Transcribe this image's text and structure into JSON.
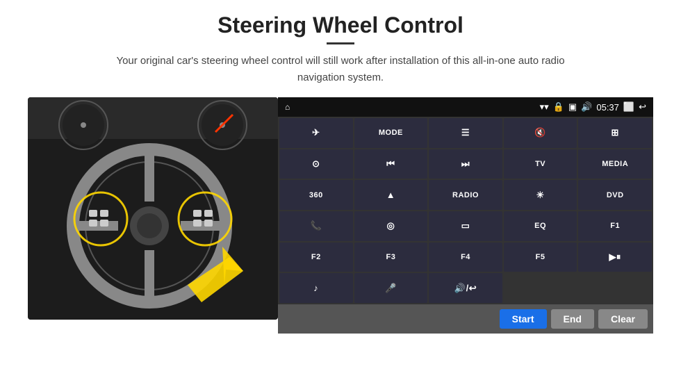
{
  "header": {
    "title": "Steering Wheel Control",
    "subtitle": "Your original car's steering wheel control will still work after installation of this all-in-one auto radio navigation system."
  },
  "status_bar": {
    "time": "05:37",
    "home_icon": "⌂",
    "wifi_icon": "wifi",
    "lock_icon": "🔒",
    "sim_icon": "📶",
    "bt_icon": "🔊",
    "window_icon": "⬜",
    "back_icon": "↩"
  },
  "buttons": [
    {
      "label": "✈",
      "row": 1,
      "col": 1
    },
    {
      "label": "MODE",
      "row": 1,
      "col": 2
    },
    {
      "label": "≡",
      "row": 1,
      "col": 3
    },
    {
      "label": "🔇",
      "row": 1,
      "col": 4
    },
    {
      "label": "⊞",
      "row": 1,
      "col": 5
    },
    {
      "label": "⊙",
      "row": 2,
      "col": 1
    },
    {
      "label": "⏮",
      "row": 2,
      "col": 2
    },
    {
      "label": "⏭",
      "row": 2,
      "col": 3
    },
    {
      "label": "TV",
      "row": 2,
      "col": 4
    },
    {
      "label": "MEDIA",
      "row": 2,
      "col": 5
    },
    {
      "label": "360",
      "row": 3,
      "col": 1
    },
    {
      "label": "▲",
      "row": 3,
      "col": 2
    },
    {
      "label": "RADIO",
      "row": 3,
      "col": 3
    },
    {
      "label": "☀",
      "row": 3,
      "col": 4
    },
    {
      "label": "DVD",
      "row": 3,
      "col": 5
    },
    {
      "label": "📞",
      "row": 4,
      "col": 1
    },
    {
      "label": "◎",
      "row": 4,
      "col": 2
    },
    {
      "label": "▭",
      "row": 4,
      "col": 3
    },
    {
      "label": "EQ",
      "row": 4,
      "col": 4
    },
    {
      "label": "F1",
      "row": 4,
      "col": 5
    },
    {
      "label": "F2",
      "row": 5,
      "col": 1
    },
    {
      "label": "F3",
      "row": 5,
      "col": 2
    },
    {
      "label": "F4",
      "row": 5,
      "col": 3
    },
    {
      "label": "F5",
      "row": 5,
      "col": 4
    },
    {
      "label": "▶⏸",
      "row": 5,
      "col": 5
    },
    {
      "label": "♪",
      "row": 6,
      "col": 1
    },
    {
      "label": "🎤",
      "row": 6,
      "col": 2
    },
    {
      "label": "🔊/↩",
      "row": 6,
      "col": 3
    }
  ],
  "action_bar": {
    "start_label": "Start",
    "end_label": "End",
    "clear_label": "Clear"
  }
}
